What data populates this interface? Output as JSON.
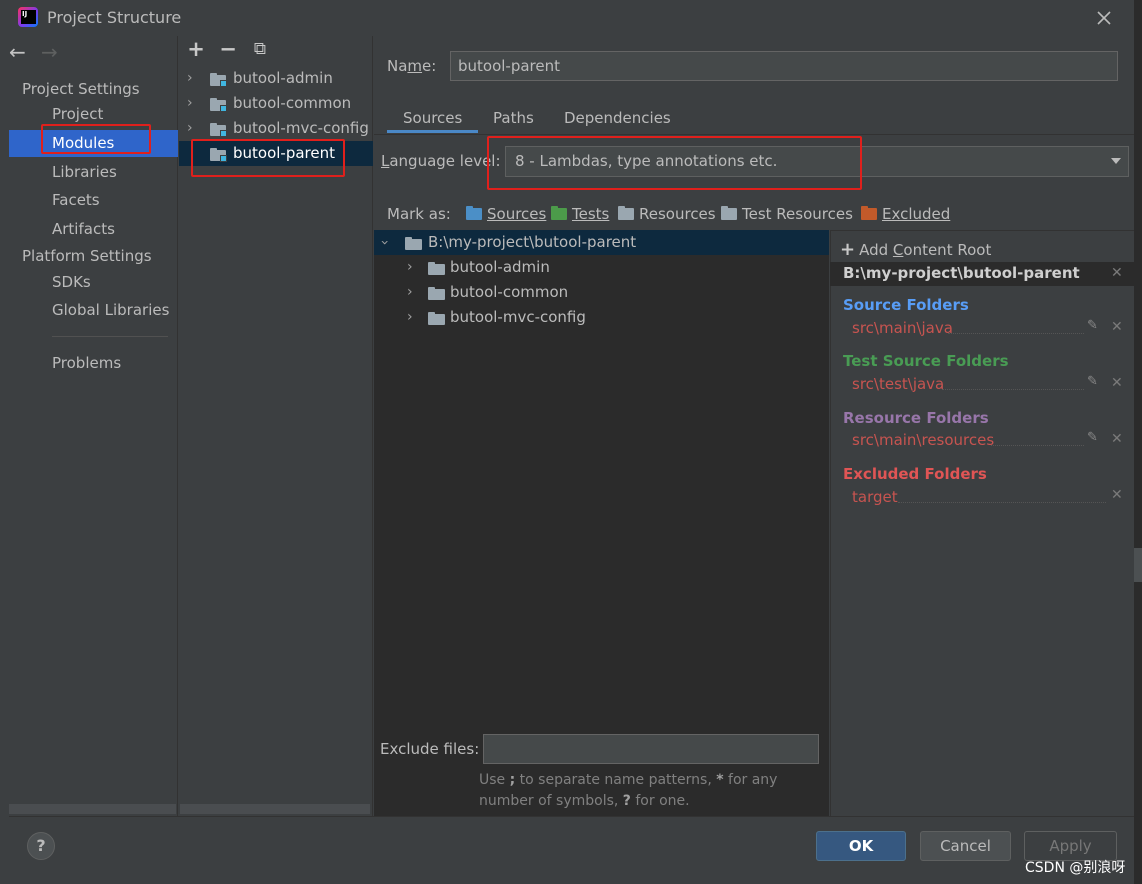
{
  "window": {
    "title": "Project Structure",
    "close_label": "×"
  },
  "nav": {
    "back_label": "←",
    "forward_label": "→",
    "project_settings_header": "Project Settings",
    "items_project": [
      "Project",
      "Modules",
      "Libraries",
      "Facets",
      "Artifacts"
    ],
    "platform_settings_header": "Platform Settings",
    "items_platform": [
      "SDKs",
      "Global Libraries"
    ],
    "problems_label": "Problems",
    "selected": "Modules"
  },
  "modules": {
    "toolbar": {
      "add_label": "+",
      "remove_label": "−",
      "copy_label": "⧉"
    },
    "items": [
      {
        "name": "butool-admin",
        "expandable": true
      },
      {
        "name": "butool-common",
        "expandable": true
      },
      {
        "name": "butool-mvc-config",
        "expandable": true
      },
      {
        "name": "butool-parent",
        "expandable": false
      }
    ],
    "selected": "butool-parent"
  },
  "main": {
    "name_label": "Name:",
    "name_value": "butool-parent",
    "tabs": [
      "Sources",
      "Paths",
      "Dependencies"
    ],
    "active_tab": "Sources",
    "language_level_label": "Language level:",
    "language_level_value": "8 - Lambdas, type annotations etc.",
    "mark_as_label": "Mark as:",
    "mark_as": [
      {
        "label": "Sources",
        "color": "#4b8fc7"
      },
      {
        "label": "Tests",
        "color": "#4c9b4a"
      },
      {
        "label": "Resources",
        "color": "#9aa7b0"
      },
      {
        "label": "Test Resources",
        "color": "#9aa7b0"
      },
      {
        "label": "Excluded",
        "color": "#c25a2a"
      }
    ],
    "tree": {
      "root": "B:\\my-project\\butool-parent",
      "children": [
        "butool-admin",
        "butool-common",
        "butool-mvc-config"
      ]
    },
    "exclude_files_label": "Exclude files:",
    "exclude_files_value": "",
    "hint_line1_a": "Use ",
    "hint_line1_b": ";",
    "hint_line1_c": " to separate name patterns, ",
    "hint_line1_d": "*",
    "hint_line1_e": " for any",
    "hint_line2_a": "number of symbols, ",
    "hint_line2_b": "?",
    "hint_line2_c": " for one."
  },
  "content_root": {
    "add_label": "Add Content Root",
    "path": "B:\\my-project\\butool-parent",
    "groups": [
      {
        "title": "Source Folders",
        "color": "#589df6",
        "path": "src\\main\\java",
        "editable": true
      },
      {
        "title": "Test Source Folders",
        "color": "#499c54",
        "path": "src\\test\\java",
        "editable": true
      },
      {
        "title": "Resource Folders",
        "color": "#9876aa",
        "path": "src\\main\\resources",
        "editable": true
      },
      {
        "title": "Excluded Folders",
        "color": "#e05555",
        "path": "target",
        "editable": false
      }
    ]
  },
  "buttons": {
    "help_label": "?",
    "ok_label": "OK",
    "cancel_label": "Cancel",
    "apply_label": "Apply"
  },
  "watermark": "CSDN @别浪呀"
}
